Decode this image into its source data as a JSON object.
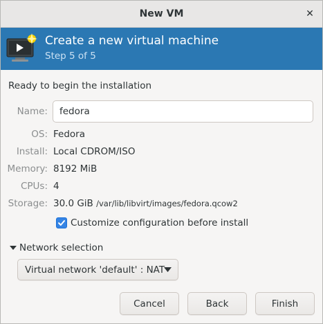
{
  "window": {
    "title": "New VM",
    "close_glyph": "✕"
  },
  "header": {
    "title": "Create a new virtual machine",
    "step": "Step 5 of 5",
    "icon": "vm-screen-new-icon"
  },
  "content": {
    "heading": "Ready to begin the installation",
    "name": {
      "label": "Name:",
      "value": "fedora"
    },
    "os": {
      "label": "OS:",
      "value": "Fedora"
    },
    "install": {
      "label": "Install:",
      "value": "Local CDROM/ISO"
    },
    "memory": {
      "label": "Memory:",
      "value": "8192 MiB"
    },
    "cpus": {
      "label": "CPUs:",
      "value": "4"
    },
    "storage": {
      "label": "Storage:",
      "value": "30.0 GiB",
      "path": "/var/lib/libvirt/images/fedora.qcow2"
    },
    "customize": {
      "label": "Customize configuration before install",
      "checked": true
    },
    "network": {
      "expander_label": "Network selection",
      "expanded": true,
      "selected": "Virtual network 'default' : NAT"
    }
  },
  "buttons": {
    "cancel": "Cancel",
    "back": "Back",
    "finish": "Finish"
  },
  "colors": {
    "header_bg": "#2b78b3",
    "checkbox_accent": "#3584e4",
    "label_gray": "#8b8e8f"
  }
}
